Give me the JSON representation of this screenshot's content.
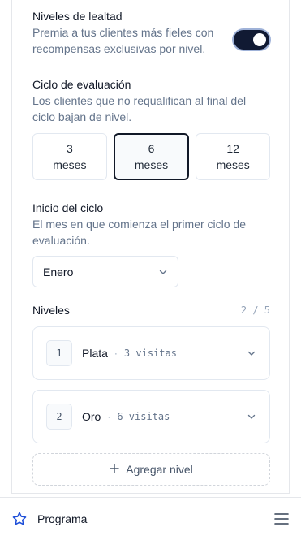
{
  "loyalty": {
    "title": "Niveles de lealtad",
    "description_line1": "Premia a tus clientes más fieles con",
    "description_line2": "recompensas exclusivas por nivel.",
    "enabled": true
  },
  "evaluation_cycle": {
    "title": "Ciclo de evaluación",
    "description_line1": "Los clientes que no requalifican al final del",
    "description_line2": "ciclo bajan de nivel.",
    "options": [
      {
        "number": "3",
        "unit": "meses"
      },
      {
        "number": "6",
        "unit": "meses"
      },
      {
        "number": "12",
        "unit": "meses"
      }
    ],
    "selected_index": 1
  },
  "cycle_start": {
    "title": "Inicio del ciclo",
    "description_line1": "El mes en que comienza el primer ciclo de",
    "description_line2": "evaluación.",
    "selected_month": "Enero"
  },
  "levels": {
    "title": "Niveles",
    "count": "2 / 5",
    "separator": "·",
    "items": [
      {
        "number": "1",
        "name": "Plata",
        "visits": "3 visitas"
      },
      {
        "number": "2",
        "name": "Oro",
        "visits": "6 visitas"
      }
    ],
    "add_label": "Agregar nivel"
  },
  "bottom_bar": {
    "label": "Programa",
    "icon": "star-icon",
    "menu_icon": "hamburger-menu-icon"
  },
  "colors": {
    "toggle_on": "#111a33",
    "accent_blue": "#1d4ed8",
    "muted_text": "#64748b"
  }
}
